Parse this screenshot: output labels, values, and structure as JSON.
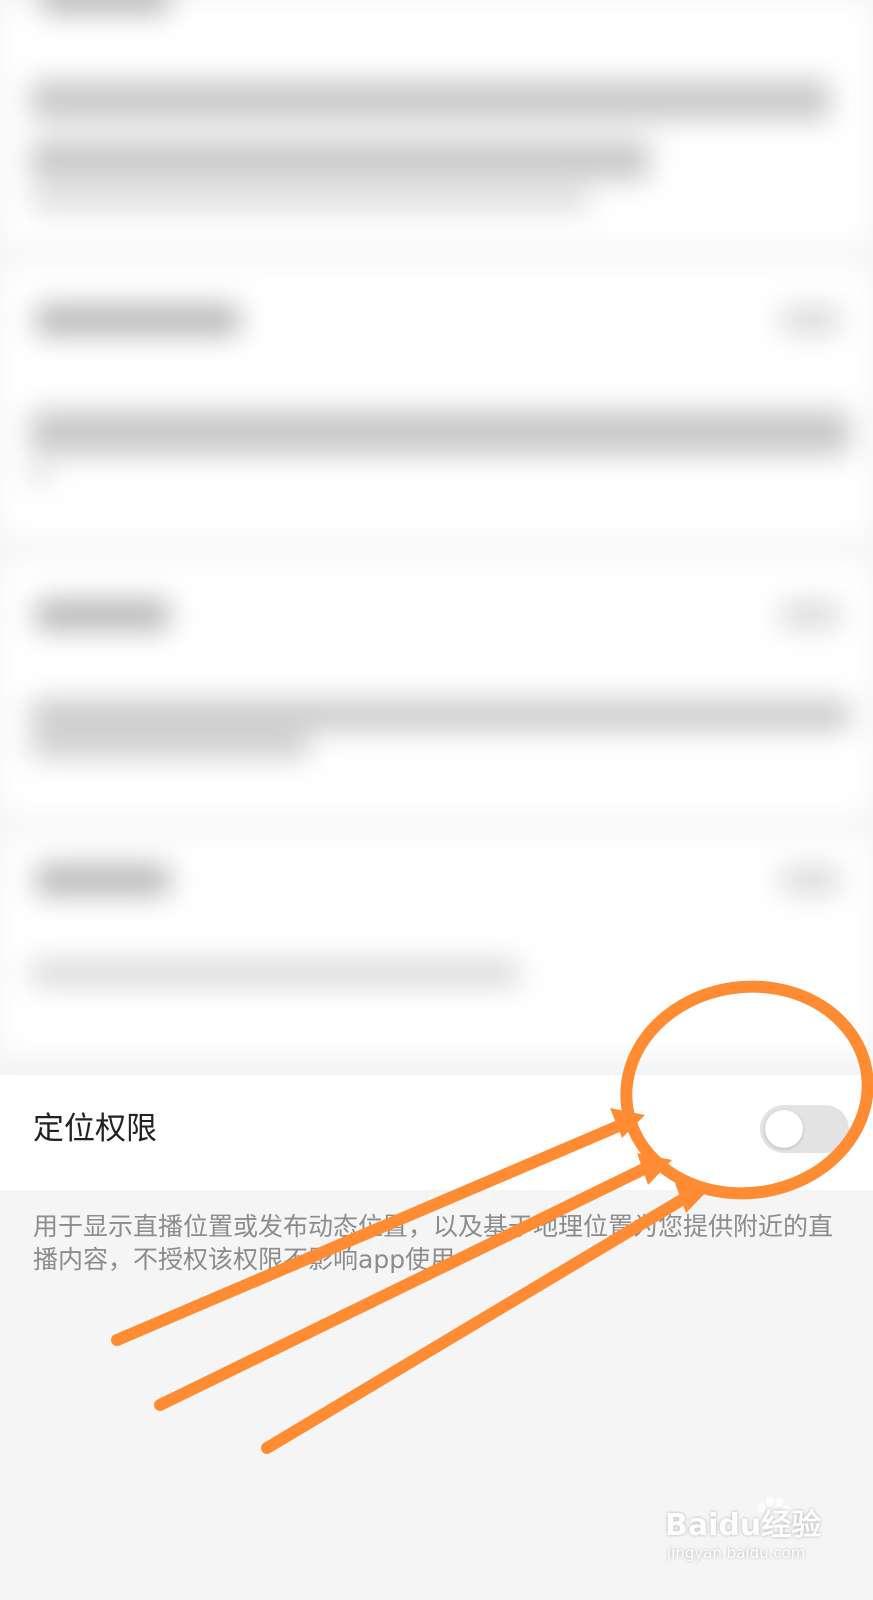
{
  "location_permission": {
    "title": "定位权限",
    "enabled": false,
    "description": "用于显示直播位置或发布动态位置，以及基于地理位置为您提供附近的直播内容，不授权该权限不影响app使用"
  },
  "annotation": {
    "color": "#ff8c33"
  },
  "watermark": {
    "logo": "Baidu经验",
    "url": "jingyan.baidu.com"
  }
}
